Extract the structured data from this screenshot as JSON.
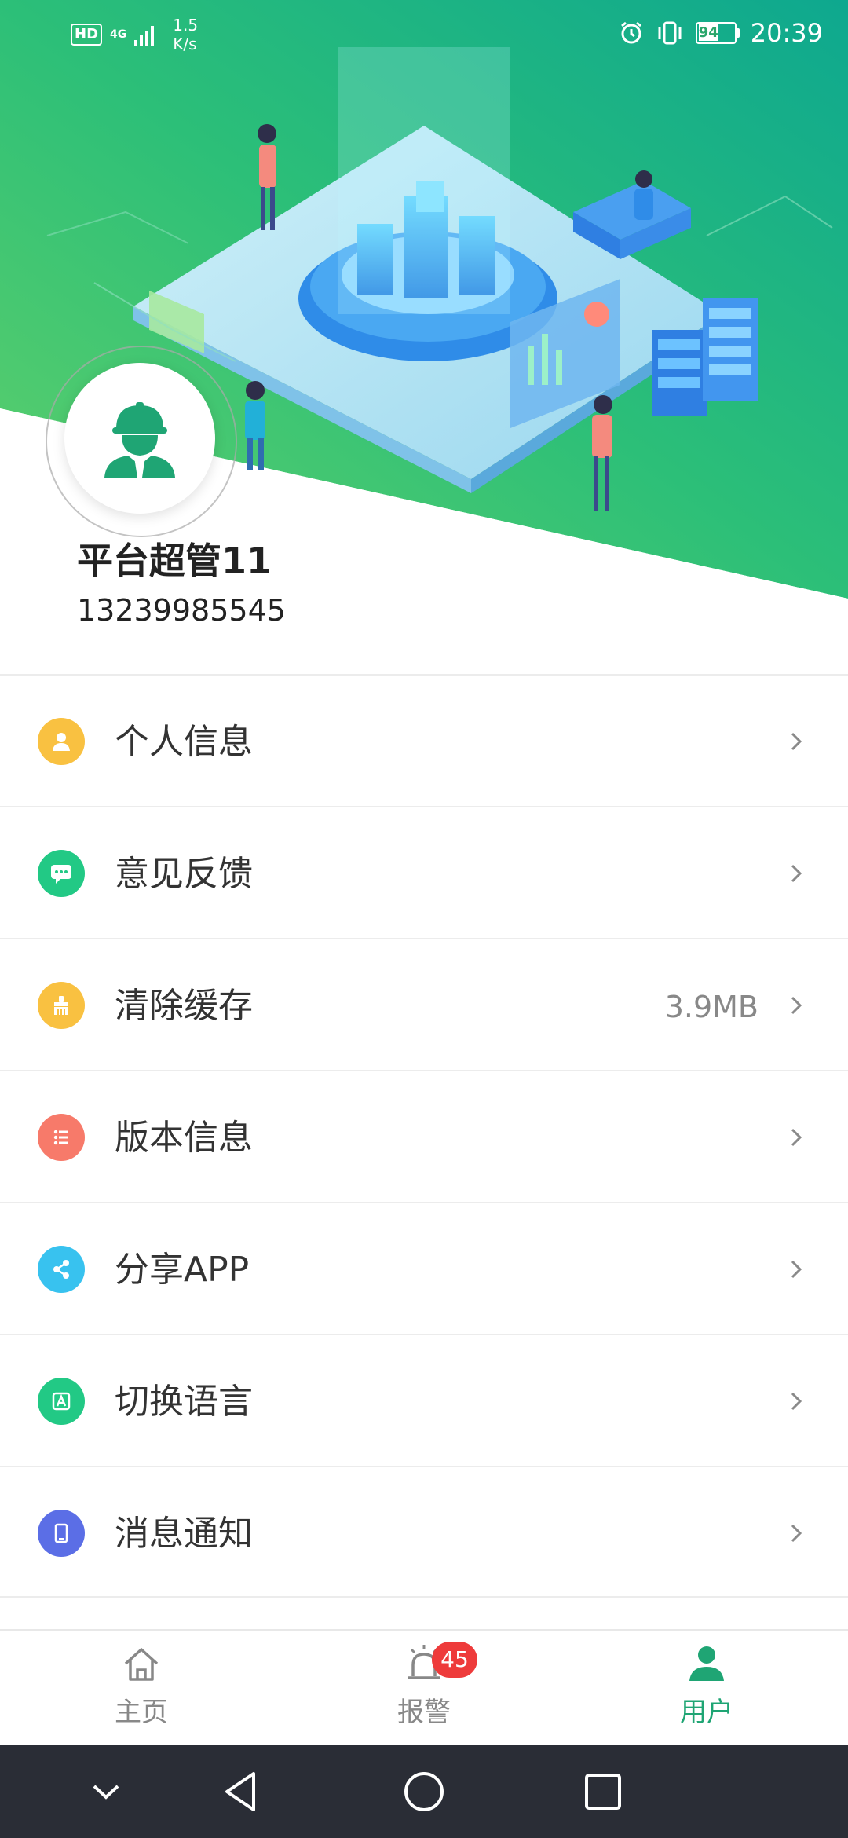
{
  "status_bar": {
    "hd_label": "HD",
    "network_label": "4G",
    "speed_value": "1.5",
    "speed_unit": "K/s",
    "battery_level": "94",
    "time": "20:39"
  },
  "profile": {
    "name": "平台超管11",
    "phone": "13239985545"
  },
  "menu": {
    "items": [
      {
        "label": "个人信息",
        "icon": "user-icon",
        "color": "#f9c141"
      },
      {
        "label": "意见反馈",
        "icon": "chat-bubble-icon",
        "color": "#22c985"
      },
      {
        "label": "清除缓存",
        "icon": "broom-icon",
        "color": "#f9c141",
        "value": "3.9MB"
      },
      {
        "label": "版本信息",
        "icon": "list-icon",
        "color": "#f77a6a"
      },
      {
        "label": "分享APP",
        "icon": "share-icon",
        "color": "#38c2ef"
      },
      {
        "label": "切换语言",
        "icon": "language-icon",
        "color": "#22c985"
      },
      {
        "label": "消息通知",
        "icon": "phone-icon",
        "color": "#5b6ee6"
      }
    ]
  },
  "tabbar": {
    "tabs": [
      {
        "label": "主页",
        "icon": "home-icon",
        "active": false
      },
      {
        "label": "报警",
        "icon": "alarm-bell-icon",
        "active": false,
        "badge": "45"
      },
      {
        "label": "用户",
        "icon": "user-icon",
        "active": true
      }
    ]
  },
  "colors": {
    "accent": "#1fa574",
    "hero_start": "#4fcf6e",
    "hero_end": "#12ad92",
    "badge": "#ee3b3b",
    "nav_bar": "#2a2d36"
  }
}
